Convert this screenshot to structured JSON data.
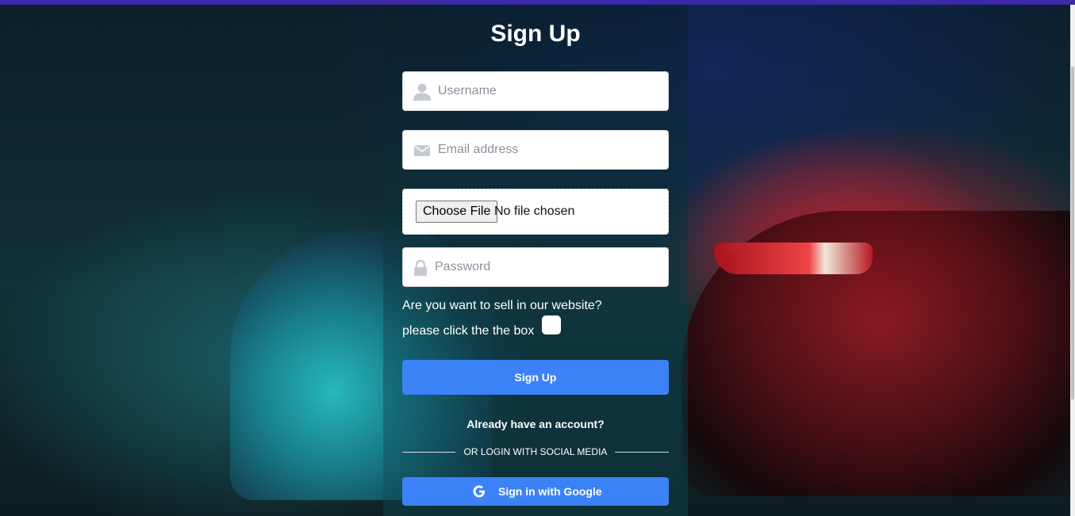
{
  "page": {
    "title": "Sign Up"
  },
  "form": {
    "username_placeholder": "Username",
    "email_placeholder": "Email address",
    "file_button_label": "Choose File",
    "file_status": "No file chosen",
    "password_placeholder": "Password",
    "seller_question": "Are you want to sell in our website?",
    "seller_hint": "please click the the box",
    "seller_checked": false,
    "submit_label": "Sign Up"
  },
  "footer": {
    "have_account": "Already have an account?",
    "divider_text": "OR LOGIN WITH SOCIAL MEDIA",
    "google_label": "Sign in with Google"
  },
  "colors": {
    "primary": "#3b82f6",
    "top_bar": "#3b2aa8",
    "panel_text": "#ffffff"
  },
  "icons": [
    "user-icon",
    "envelope-icon",
    "lock-icon",
    "google-icon"
  ]
}
